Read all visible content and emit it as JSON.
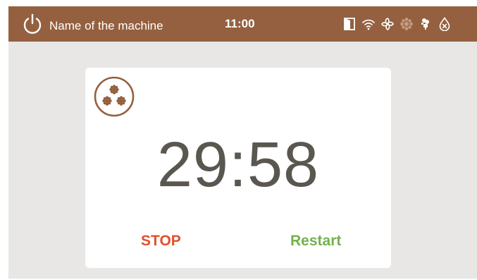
{
  "header": {
    "power_icon": "power-icon",
    "machine_name": "Name of the machine",
    "time": "11:00",
    "status_icons": [
      "door-icon",
      "wifi-icon",
      "fan-icon",
      "heater-inactive-icon",
      "steam-icon",
      "water-drop-icon"
    ]
  },
  "card": {
    "mode_icon": "triple-flower-icon",
    "timer": "29:58",
    "stop_label": "STOP",
    "restart_label": "Restart"
  },
  "colors": {
    "header_bg": "#94603f",
    "screen_bg": "#e8e7e5",
    "card_bg": "#ffffff",
    "timer_text": "#5a5650",
    "stop": "#e0512d",
    "restart": "#73b24e",
    "inactive_icon": "#c49a80"
  }
}
